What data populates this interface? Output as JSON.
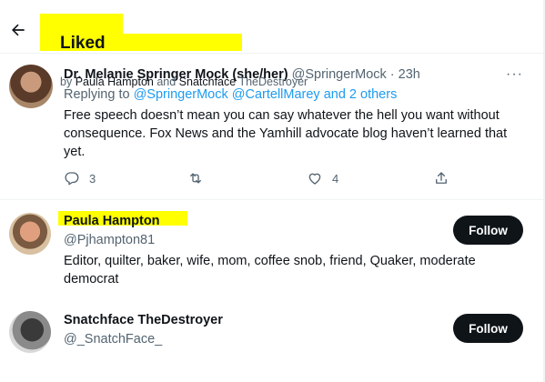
{
  "header": {
    "title": "Liked",
    "by_prefix": "by ",
    "liker1": "Paula Hampton",
    "and": " and ",
    "liker2": "Snatchface",
    "liker2_rest": " TheDestroyer"
  },
  "tweet": {
    "author_name": "Dr. Melanie Springer Mock (she/her)",
    "author_handle": "@SpringerMock",
    "separator": " · ",
    "time": "23h",
    "more": "···",
    "replying_prefix": "Replying to ",
    "replying_to": "@SpringerMock @CartellMarey and 2 others",
    "text": "Free speech doesn’t mean you can say whatever the hell you want without consequence. Fox News and the Yamhill advocate blog haven’t learned that yet.",
    "reply_count": "3",
    "retweet_count": "",
    "like_count": "4"
  },
  "users": [
    {
      "name": "Paula Hampton",
      "handle": "@Pjhampton81",
      "bio": "Editor, quilter, baker, wife, mom, coffee snob, friend, Quaker, moderate democrat",
      "follow_label": "Follow"
    },
    {
      "name": "Snatchface TheDestroyer",
      "handle": "@_SnatchFace_",
      "bio": "",
      "follow_label": "Follow"
    }
  ],
  "icons": {
    "back": "back-arrow-icon",
    "reply": "reply-icon",
    "retweet": "retweet-icon",
    "like": "heart-icon",
    "share": "share-icon",
    "more": "more-icon"
  },
  "colors": {
    "text": "#0f1419",
    "secondary": "#536471",
    "link": "#1d9bf0",
    "highlight": "#ffff00",
    "button": "#0f1419"
  }
}
